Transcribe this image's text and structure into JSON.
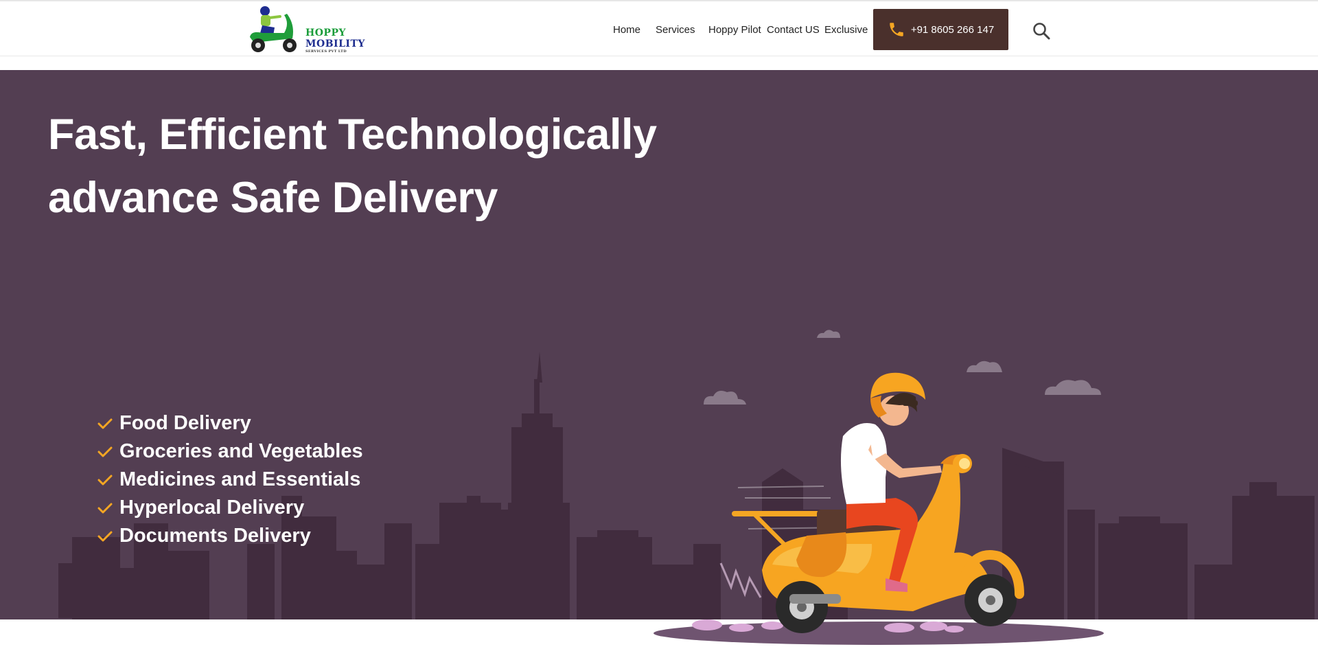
{
  "brand": {
    "logo_line1": "HOPPY",
    "logo_line2": "MOBILITY",
    "logo_line3": "SERVICES PVT LTD",
    "colors": {
      "green": "#1a9c3a",
      "navy": "#1e2d8f"
    }
  },
  "nav": {
    "items": [
      {
        "label": "Home"
      },
      {
        "label": "Services"
      },
      {
        "label": "Hoppy Pilot"
      },
      {
        "label": "Contact US"
      },
      {
        "label": "Exclusive"
      }
    ],
    "phone_label": "+91 8605 266 147",
    "phone_icon": "phone-icon",
    "search_icon": "search-icon"
  },
  "hero": {
    "headline_line1": "Fast, Efficient Technologically",
    "headline_line2": "advance Safe Delivery",
    "features": [
      "Food Delivery",
      "Groceries and Vegetables",
      "Medicines and Essentials",
      "Hyperlocal Delivery",
      "Documents Delivery"
    ],
    "check_icon": "check-icon",
    "colors": {
      "background": "#533e52",
      "skyline": "#412c3e",
      "accent": "#f5a623",
      "button": "#4a302c"
    }
  }
}
